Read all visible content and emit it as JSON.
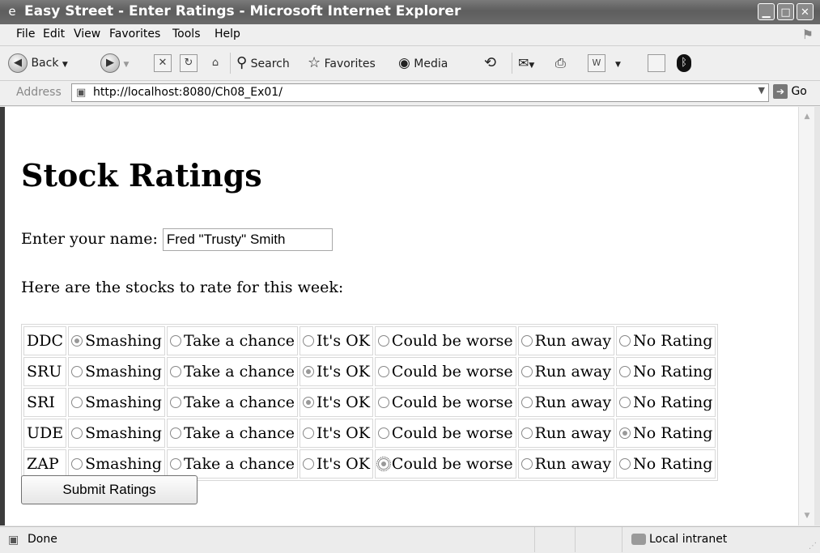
{
  "window": {
    "title": "Easy Street - Enter Ratings - Microsoft Internet Explorer",
    "minimize_glyph": "▁",
    "maximize_glyph": "□",
    "close_glyph": "✕"
  },
  "menu": {
    "items": [
      "File",
      "Edit",
      "View",
      "Favorites",
      "Tools",
      "Help"
    ]
  },
  "toolbar": {
    "back_label": "Back",
    "search_label": "Search",
    "favorites_label": "Favorites",
    "media_label": "Media"
  },
  "address": {
    "label": "Address",
    "url": "http://localhost:8080/Ch08_Ex01/",
    "go_label": "Go"
  },
  "page": {
    "heading": "Stock Ratings",
    "name_label": "Enter your name:",
    "name_value": "Fred \"Trusty\" Smith",
    "intro": "Here are the stocks to rate for this week:",
    "submit_label": "Submit Ratings",
    "options": [
      "Smashing",
      "Take a chance",
      "It's OK",
      "Could be worse",
      "Run away",
      "No Rating"
    ],
    "stocks": [
      {
        "symbol": "DDC",
        "selected": 0
      },
      {
        "symbol": "SRU",
        "selected": 2
      },
      {
        "symbol": "SRI",
        "selected": 2
      },
      {
        "symbol": "UDE",
        "selected": 5
      },
      {
        "symbol": "ZAP",
        "selected": 3,
        "focused": 3
      }
    ]
  },
  "status": {
    "text": "Done",
    "zone": "Local intranet"
  }
}
